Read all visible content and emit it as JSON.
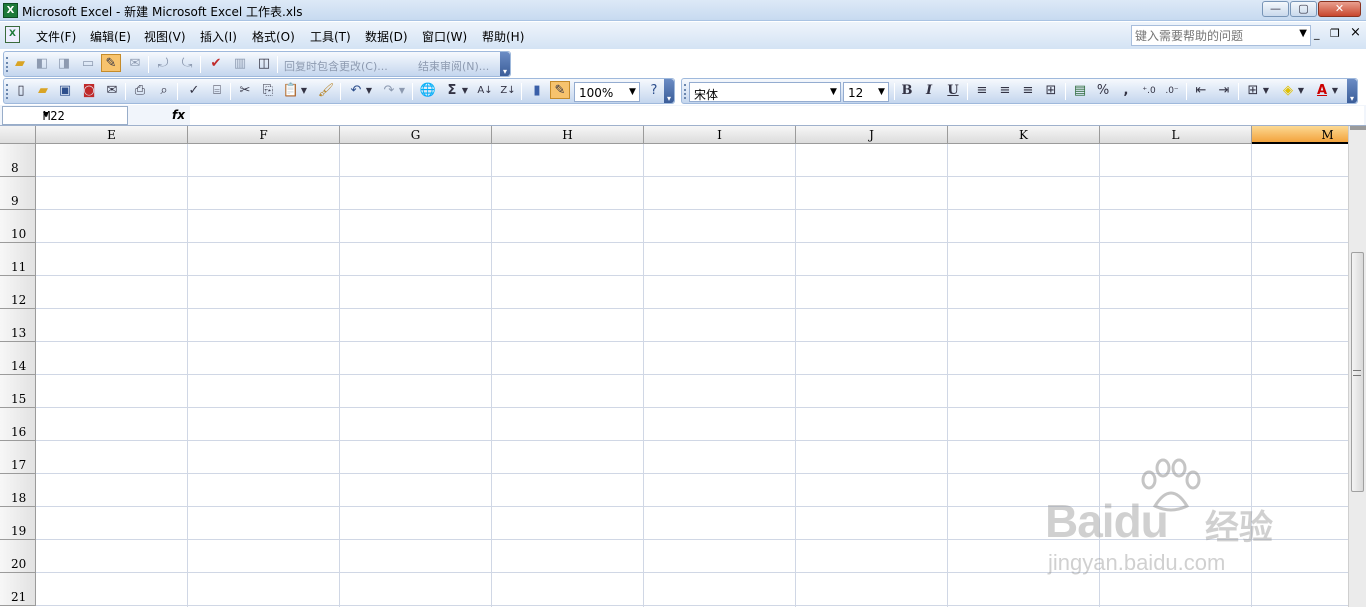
{
  "window": {
    "title": "Microsoft Excel - 新建 Microsoft Excel 工作表.xls",
    "minimize": "—",
    "maximize": "▢",
    "close": "✕"
  },
  "menu": {
    "items": [
      "文件(F)",
      "编辑(E)",
      "视图(V)",
      "插入(I)",
      "格式(O)",
      "工具(T)",
      "数据(D)",
      "窗口(W)",
      "帮助(H)"
    ],
    "help_placeholder": "键入需要帮助的问题",
    "mdi_min": "_",
    "mdi_restore": "❐",
    "mdi_close": "×"
  },
  "review_toolbar": {
    "reply_label": "回复时包含更改(C)...",
    "end_review_label": "结束审阅(N)..."
  },
  "standard_toolbar": {
    "zoom": "100%",
    "sigma": "Σ"
  },
  "format_toolbar": {
    "font": "宋体",
    "size": "12",
    "bold": "B",
    "italic": "I",
    "underline": "U",
    "percent": "%",
    "comma": ","
  },
  "formula_bar": {
    "name_box": "M22",
    "fx": "fx",
    "formula": ""
  },
  "sheet": {
    "columns": [
      "E",
      "F",
      "G",
      "H",
      "I",
      "J",
      "K",
      "L",
      "M"
    ],
    "selected_column": "M",
    "rows": [
      "8",
      "9",
      "10",
      "11",
      "12",
      "13",
      "14",
      "15",
      "16",
      "17",
      "18",
      "19",
      "20",
      "21"
    ]
  },
  "watermark": {
    "brand": "Baidu",
    "cn": "经验",
    "url": "jingyan.baidu.com"
  },
  "colors": {
    "selected_header": "#f3a33d",
    "gridline": "#d0d7e5",
    "toolbar": "#c4d6ee"
  }
}
